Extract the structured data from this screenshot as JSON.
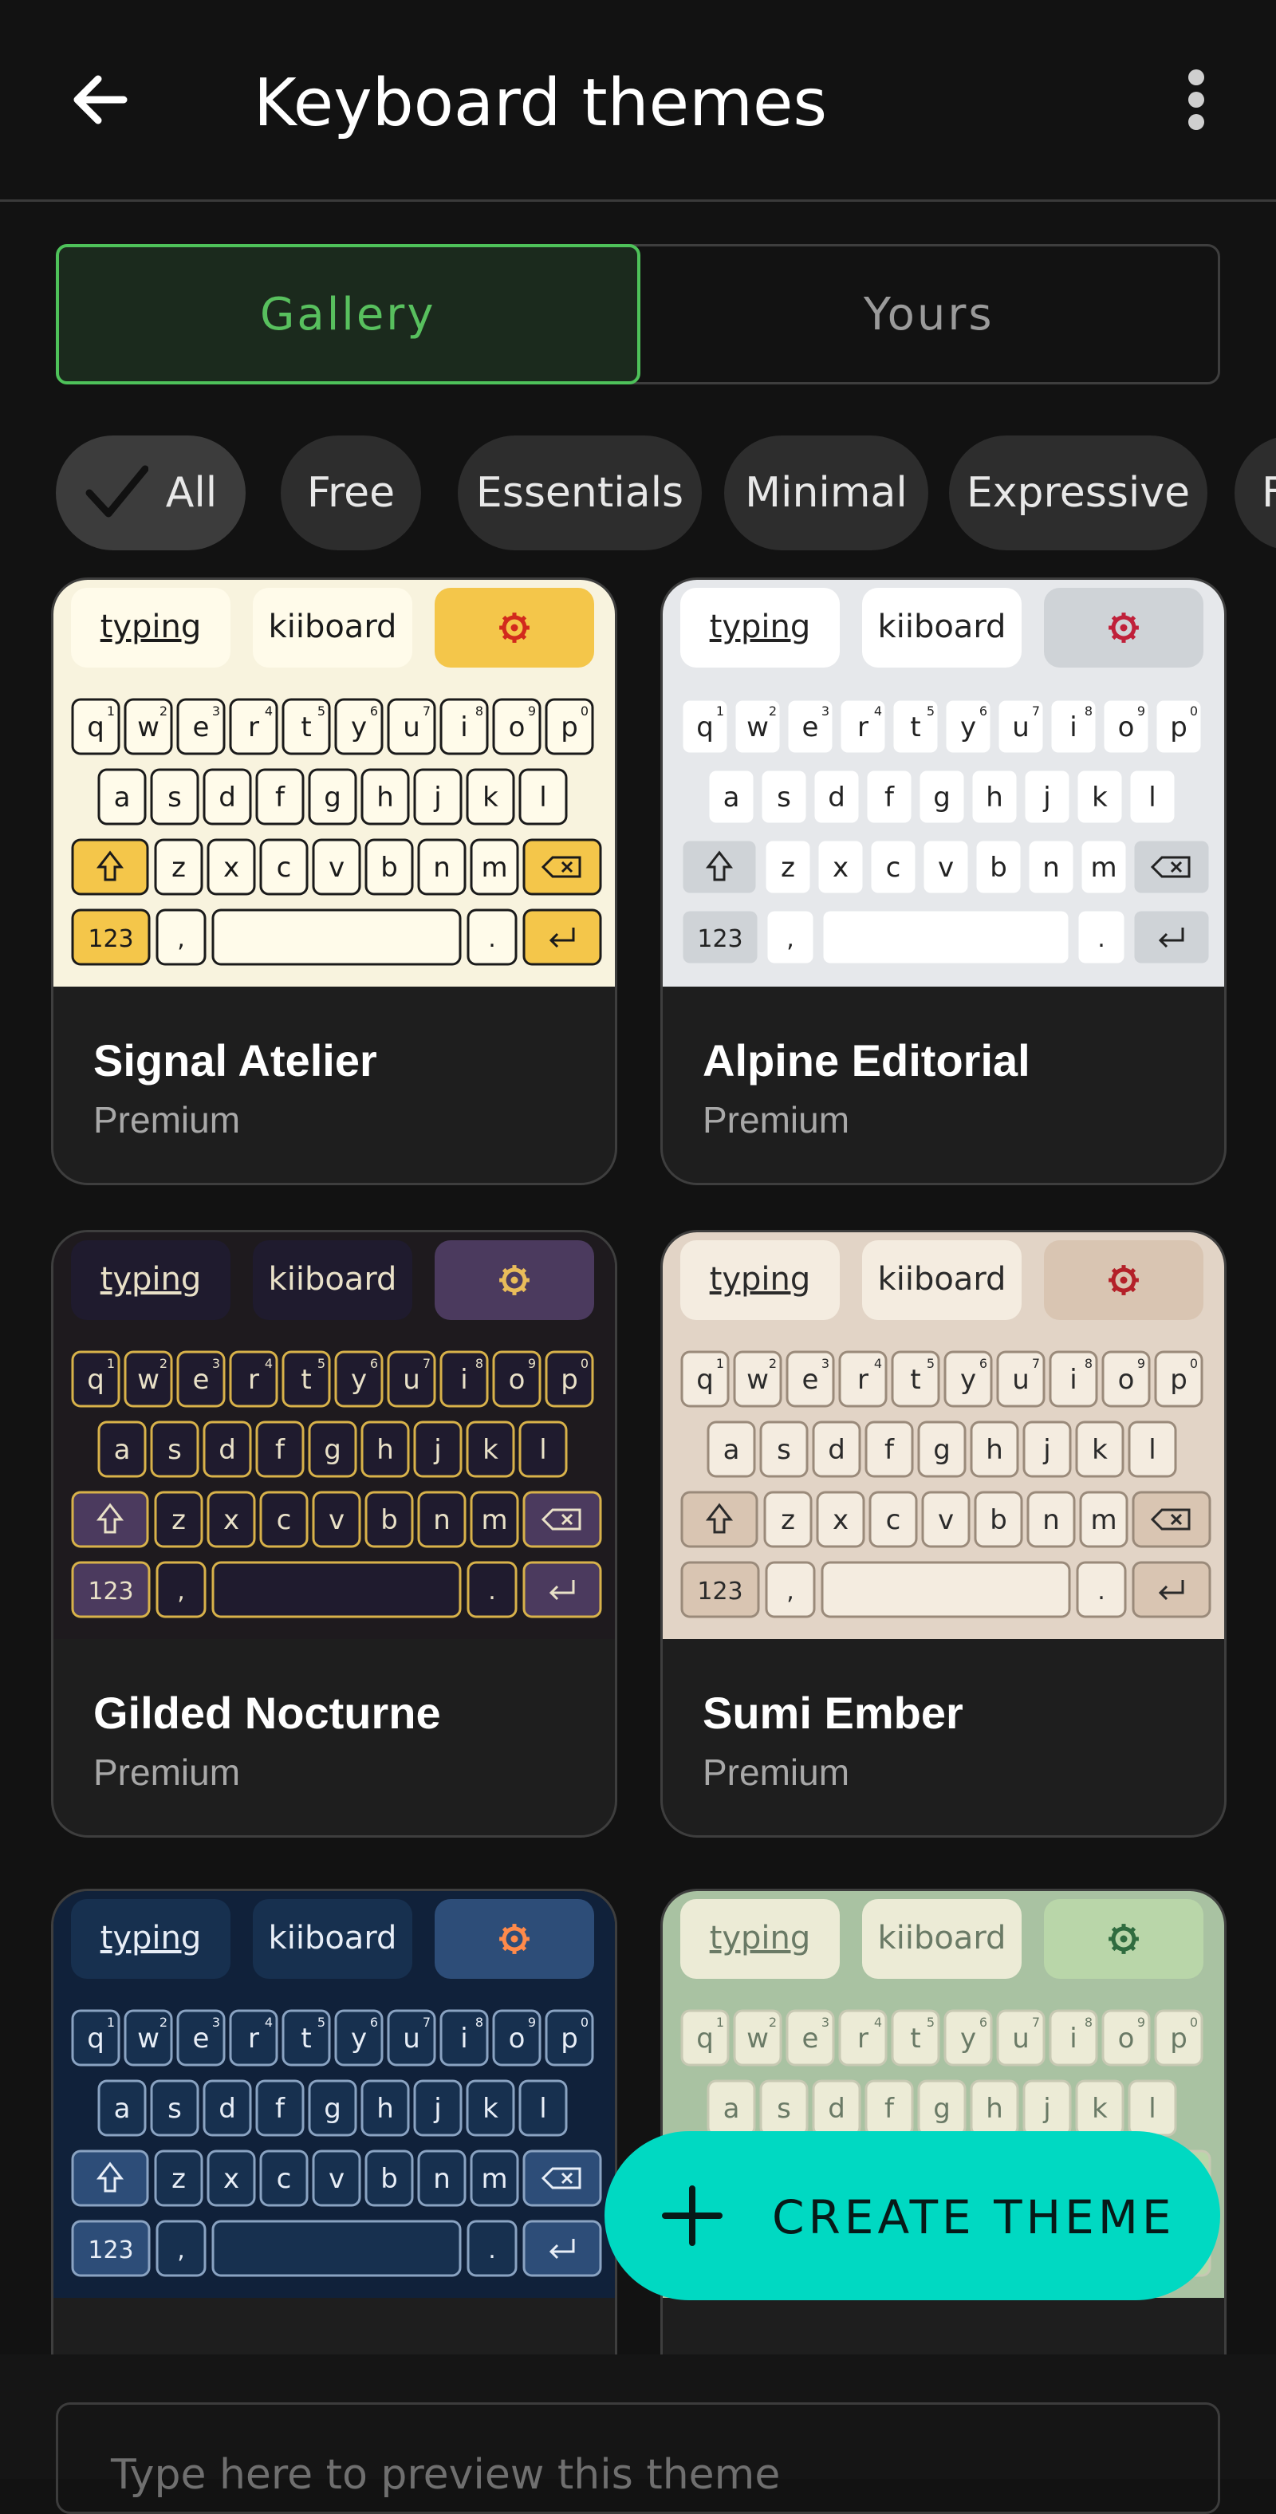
{
  "app": {
    "title": "Keyboard themes",
    "back_icon": "arrow-left-icon",
    "more_icon": "more-vert-icon"
  },
  "tabs": [
    {
      "label": "Gallery",
      "active": true
    },
    {
      "label": "Yours",
      "active": false
    }
  ],
  "filters": [
    {
      "label": "All",
      "selected": true
    },
    {
      "label": "Free",
      "selected": false
    },
    {
      "label": "Essentials",
      "selected": false
    },
    {
      "label": "Minimal",
      "selected": false
    },
    {
      "label": "Expressive",
      "selected": false
    },
    {
      "label": "F",
      "selected": false
    }
  ],
  "keyboard_preview": {
    "suggestions": [
      "typing",
      "kiiboard"
    ],
    "settings_icon": "gear-icon",
    "rows": [
      [
        "q",
        "w",
        "e",
        "r",
        "t",
        "y",
        "u",
        "i",
        "o",
        "p"
      ],
      [
        "a",
        "s",
        "d",
        "f",
        "g",
        "h",
        "j",
        "k",
        "l"
      ],
      [
        "z",
        "x",
        "c",
        "v",
        "b",
        "n",
        "m"
      ]
    ],
    "number_hints": [
      "1",
      "2",
      "3",
      "4",
      "5",
      "6",
      "7",
      "8",
      "9",
      "0"
    ],
    "numbers_key": "123",
    "comma_key": ",",
    "period_key": ".",
    "shift_icon": "shift-icon",
    "backspace_icon": "backspace-icon",
    "enter_icon": "enter-icon"
  },
  "themes": [
    {
      "name": "Signal Atelier",
      "tier": "Premium",
      "colors": {
        "bg": "#f8f3de",
        "key": "#fffbea",
        "keyBorder": "#1a1a1a",
        "accent": "#f4c64a",
        "text": "#1a1a1a",
        "gear": "#d22a1d"
      }
    },
    {
      "name": "Alpine Editorial",
      "tier": "Premium",
      "colors": {
        "bg": "#e6e8eb",
        "key": "#ffffff",
        "keyBorder": "#e6e8eb",
        "accent": "#cfd3d7",
        "text": "#222222",
        "gear": "#c0203a"
      }
    },
    {
      "name": "Gilded Nocturne",
      "tier": "Premium",
      "colors": {
        "bg": "#1e1a1e",
        "key": "#1f1b2e",
        "keyBorder": "#d8b24a",
        "accent": "#4b3a5e",
        "text": "#e9e1c8",
        "gear": "#e9bc5a"
      }
    },
    {
      "name": "Sumi Ember",
      "tier": "Premium",
      "colors": {
        "bg": "#e2d4c6",
        "key": "#f4ece0",
        "keyBorder": "#9a8a7a",
        "accent": "#d9c5b2",
        "text": "#2a2a2a",
        "gear": "#b42028"
      }
    },
    {
      "name": "",
      "tier": "",
      "colors": {
        "bg": "#10213a",
        "key": "#17304f",
        "keyBorder": "#8aa3c2",
        "accent": "#2d4d78",
        "text": "#e8eef7",
        "gear": "#ff8a4a"
      }
    },
    {
      "name": "",
      "tier": "",
      "colors": {
        "bg": "#a9c2a2",
        "key": "#ecebd6",
        "keyBorder": "#c7c9b3",
        "accent": "#b9d6a9",
        "text": "#6a7a66",
        "gear": "#2f6c3f"
      }
    }
  ],
  "fab": {
    "label": "CREATE THEME",
    "icon": "plus-icon"
  },
  "preview_input": {
    "placeholder": "Type here to preview this theme"
  }
}
